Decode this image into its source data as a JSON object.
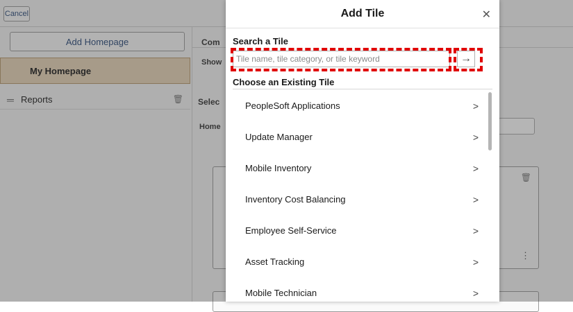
{
  "header": {
    "cancel_label": "Cancel"
  },
  "sidebar": {
    "add_homepage_label": "Add Homepage",
    "selected_homepage": "My Homepage",
    "items": [
      {
        "label": "Reports"
      }
    ]
  },
  "background": {
    "section_com": "Com",
    "show_label": "Show",
    "select_label": "Selec",
    "home_label": "Home"
  },
  "modal": {
    "title": "Add Tile",
    "close_icon": "close-icon",
    "search": {
      "label": "Search a Tile",
      "placeholder": "Tile name, tile category, or tile keyword",
      "value": "",
      "go_icon": "arrow-right-icon"
    },
    "existing_label": "Choose an Existing Tile",
    "tiles": [
      {
        "label": "PeopleSoft Applications"
      },
      {
        "label": "Update Manager"
      },
      {
        "label": "Mobile Inventory"
      },
      {
        "label": "Inventory Cost Balancing"
      },
      {
        "label": "Employee Self-Service"
      },
      {
        "label": "Asset Tracking"
      },
      {
        "label": "Mobile Technician"
      }
    ],
    "highlight_color": "#e00000"
  }
}
